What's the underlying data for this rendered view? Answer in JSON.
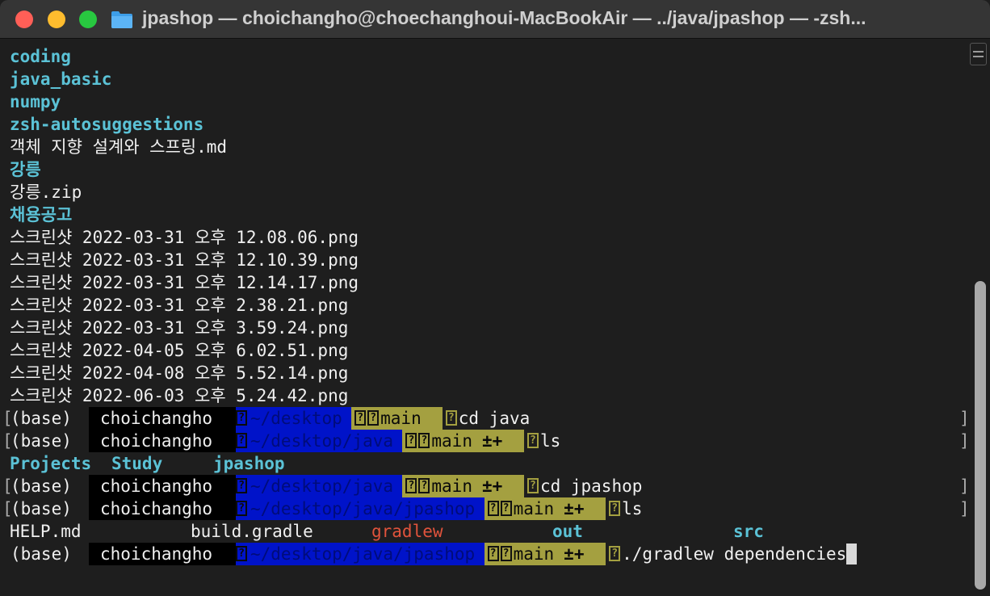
{
  "window": {
    "title": "jpashop — choichangho@choechanghoui-MacBookAir — ../java/jpashop — -zsh...",
    "folder_icon": "folder-icon"
  },
  "colors": {
    "background": "#1e1e1e",
    "dir_color": "#5bc2d6",
    "prompt_user_bg": "#000000",
    "prompt_dir_bg": "#0013c9",
    "prompt_git_bg": "#a4a040",
    "executable": "#e0533c"
  },
  "listing": [
    {
      "text": "coding",
      "type": "dir"
    },
    {
      "text": "java_basic",
      "type": "dir"
    },
    {
      "text": "numpy",
      "type": "dir"
    },
    {
      "text": "zsh-autosuggestions",
      "type": "dir"
    },
    {
      "text": "객체 지향 설계와 스프링.md",
      "type": "file"
    },
    {
      "text": "강릉",
      "type": "dir"
    },
    {
      "text": "강릉.zip",
      "type": "file"
    },
    {
      "text": "채용공고",
      "type": "dir"
    },
    {
      "text": "스크린샷 2022-03-31 오후 12.08.06.png",
      "type": "file"
    },
    {
      "text": "스크린샷 2022-03-31 오후 12.10.39.png",
      "type": "file"
    },
    {
      "text": "스크린샷 2022-03-31 오후 12.14.17.png",
      "type": "file"
    },
    {
      "text": "스크린샷 2022-03-31 오후 2.38.21.png",
      "type": "file"
    },
    {
      "text": "스크린샷 2022-03-31 오후 3.59.24.png",
      "type": "file"
    },
    {
      "text": "스크린샷 2022-04-05 오후 6.02.51.png",
      "type": "file"
    },
    {
      "text": "스크린샷 2022-04-08 오후 5.52.14.png",
      "type": "file"
    },
    {
      "text": "스크린샷 2022-06-03 오후 5.24.42.png",
      "type": "file"
    }
  ],
  "prompts": [
    {
      "env": "(base)",
      "user": "choichangho",
      "dir": "~/desktop",
      "branch": "main",
      "status": "",
      "command": "cd java"
    },
    {
      "env": "(base)",
      "user": "choichangho",
      "dir": "~/desktop/java",
      "branch": "main",
      "status": "±+",
      "command": "ls"
    },
    {
      "env": "(base)",
      "user": "choichangho",
      "dir": "~/desktop/java",
      "branch": "main",
      "status": "±+",
      "command": "cd jpashop"
    },
    {
      "env": "(base)",
      "user": "choichangho",
      "dir": "~/desktop/java/jpashop",
      "branch": "main",
      "status": "±+",
      "command": "ls"
    },
    {
      "env": "(base)",
      "user": "choichangho",
      "dir": "~/desktop/java/jpashop",
      "branch": "main",
      "status": "±+",
      "command": "./gradlew dependencies"
    }
  ],
  "ls_java": [
    "Projects",
    "Study",
    "jpashop"
  ],
  "ls_jpashop": [
    "HELP.md",
    "build.gradle",
    "gradlew",
    "out",
    "src"
  ],
  "glyph_char": "?",
  "bracket_left": "[",
  "bracket_right": "]"
}
